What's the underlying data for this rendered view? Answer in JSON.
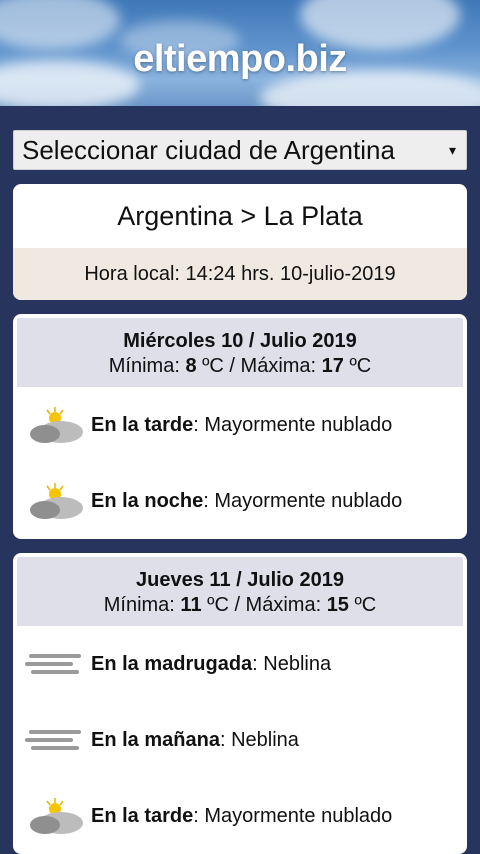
{
  "site": {
    "logo": "eltiempo.biz"
  },
  "city_select": {
    "label": "Seleccionar ciudad de Argentina",
    "arrow": "▾"
  },
  "location": {
    "breadcrumb": "Argentina > La Plata",
    "local_time": "Hora local: 14:24 hrs. 10-julio-2019"
  },
  "days": [
    {
      "title": "Miércoles 10 / Julio 2019",
      "min_label": "Mínima: ",
      "min": "8",
      "unit": " ºC / Máxima: ",
      "max": "17",
      "unit2": " ºC",
      "periods": [
        {
          "period": "En la tarde",
          "sep": ": ",
          "desc": "Mayormente nublado",
          "icon": "partly-cloudy-icon"
        },
        {
          "period": "En la noche",
          "sep": ": ",
          "desc": "Mayormente nublado",
          "icon": "partly-cloudy-icon"
        }
      ]
    },
    {
      "title": "Jueves 11 / Julio 2019",
      "min_label": "Mínima: ",
      "min": "11",
      "unit": " ºC / Máxima: ",
      "max": "15",
      "unit2": " ºC",
      "periods": [
        {
          "period": "En la madrugada",
          "sep": ": ",
          "desc": "Neblina",
          "icon": "fog-icon"
        },
        {
          "period": "En la mañana",
          "sep": ": ",
          "desc": "Neblina",
          "icon": "fog-icon"
        },
        {
          "period": "En la tarde",
          "sep": ": ",
          "desc": "Mayormente nublado",
          "icon": "partly-cloudy-icon"
        }
      ]
    }
  ]
}
